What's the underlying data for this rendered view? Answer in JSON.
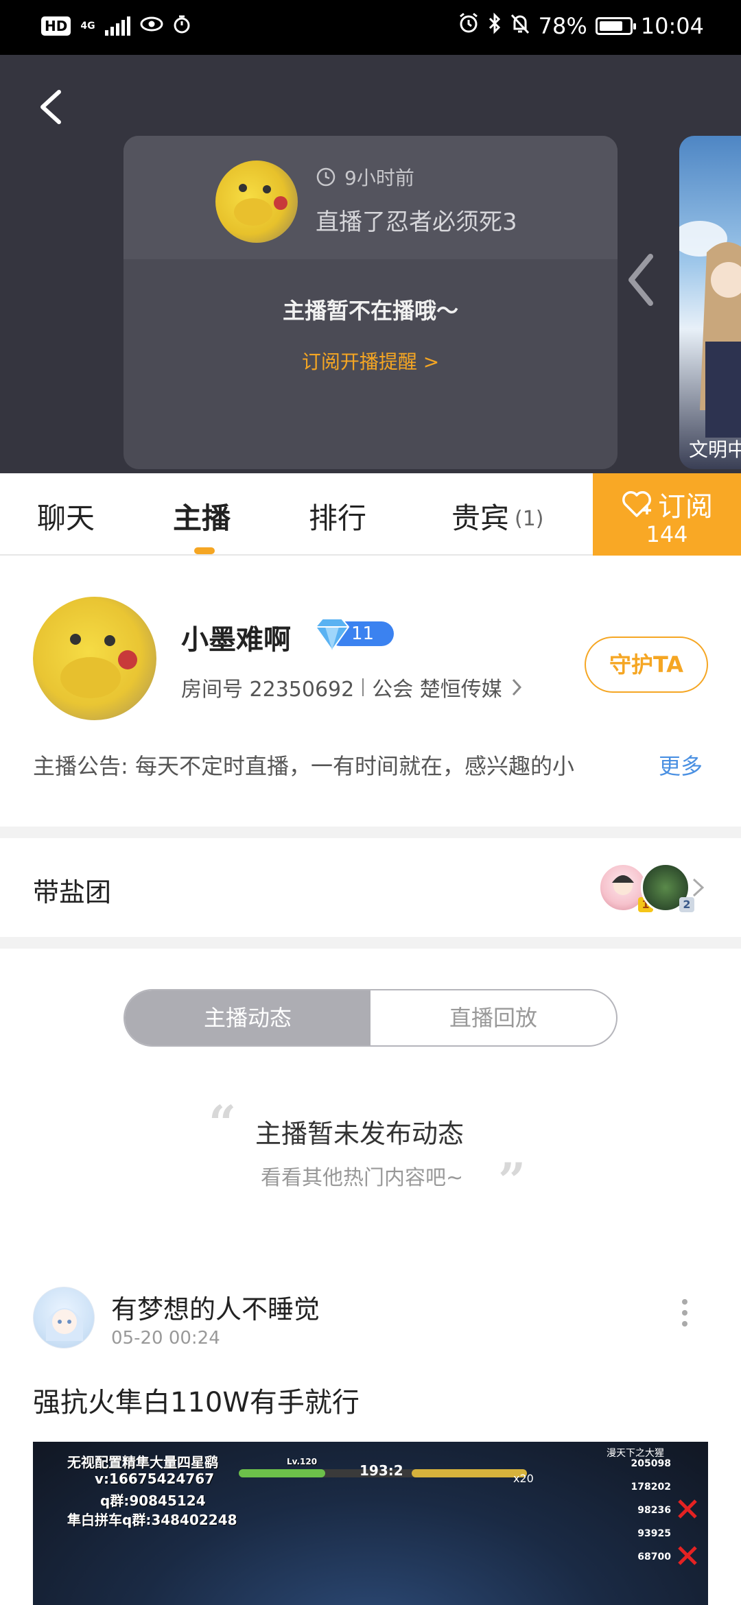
{
  "status_bar": {
    "hd": "HD",
    "network": "4G",
    "battery": "78%",
    "time": "10:04"
  },
  "header": {
    "card": {
      "time_ago": "9小时前",
      "last_stream": "直播了忍者必须死3",
      "status": "主播暂不在播哦～",
      "subscribe_reminder": "订阅开播提醒 >"
    },
    "side_card_text": "文明中"
  },
  "tabs": [
    {
      "label": "聊天"
    },
    {
      "label": "主播"
    },
    {
      "label": "排行"
    },
    {
      "label": "贵宾",
      "count": "(1)"
    }
  ],
  "subscribe": {
    "label": "订阅",
    "count": "144"
  },
  "profile": {
    "name": "小墨难啊",
    "level": "11",
    "room_label": "房间号 22350692",
    "guild_label": "公会 楚恒传媒",
    "guard_button": "守护TA",
    "announcement": "主播公告: 每天不定时直播，一有时间就在，感兴趣的小",
    "more": "更多"
  },
  "fan_group": {
    "label": "带盐团",
    "badges": [
      "1",
      "2"
    ]
  },
  "segment": {
    "options": [
      "主播动态",
      "直播回放"
    ],
    "selected": "主播动态"
  },
  "empty_state": {
    "title": "主播暂未发布动态",
    "subtitle": "看看其他热门内容吧~"
  },
  "post": {
    "author": "有梦想的人不睡觉",
    "time": "05-20 00:24",
    "title": "强抗火隼白110W有手就行",
    "media": {
      "line1": "无视配置精隼大量四星鹞",
      "line2": "v:16675424767",
      "line3": "q群:90845124",
      "line4": "隼白拼车q群:348402248",
      "level": "Lv.120",
      "score": "193:2",
      "multiplier": "x20",
      "leaderboard_title": "漫天下之大猩",
      "leaderboard": [
        "205098",
        "178202",
        "98236",
        "93925",
        "68700"
      ]
    }
  }
}
